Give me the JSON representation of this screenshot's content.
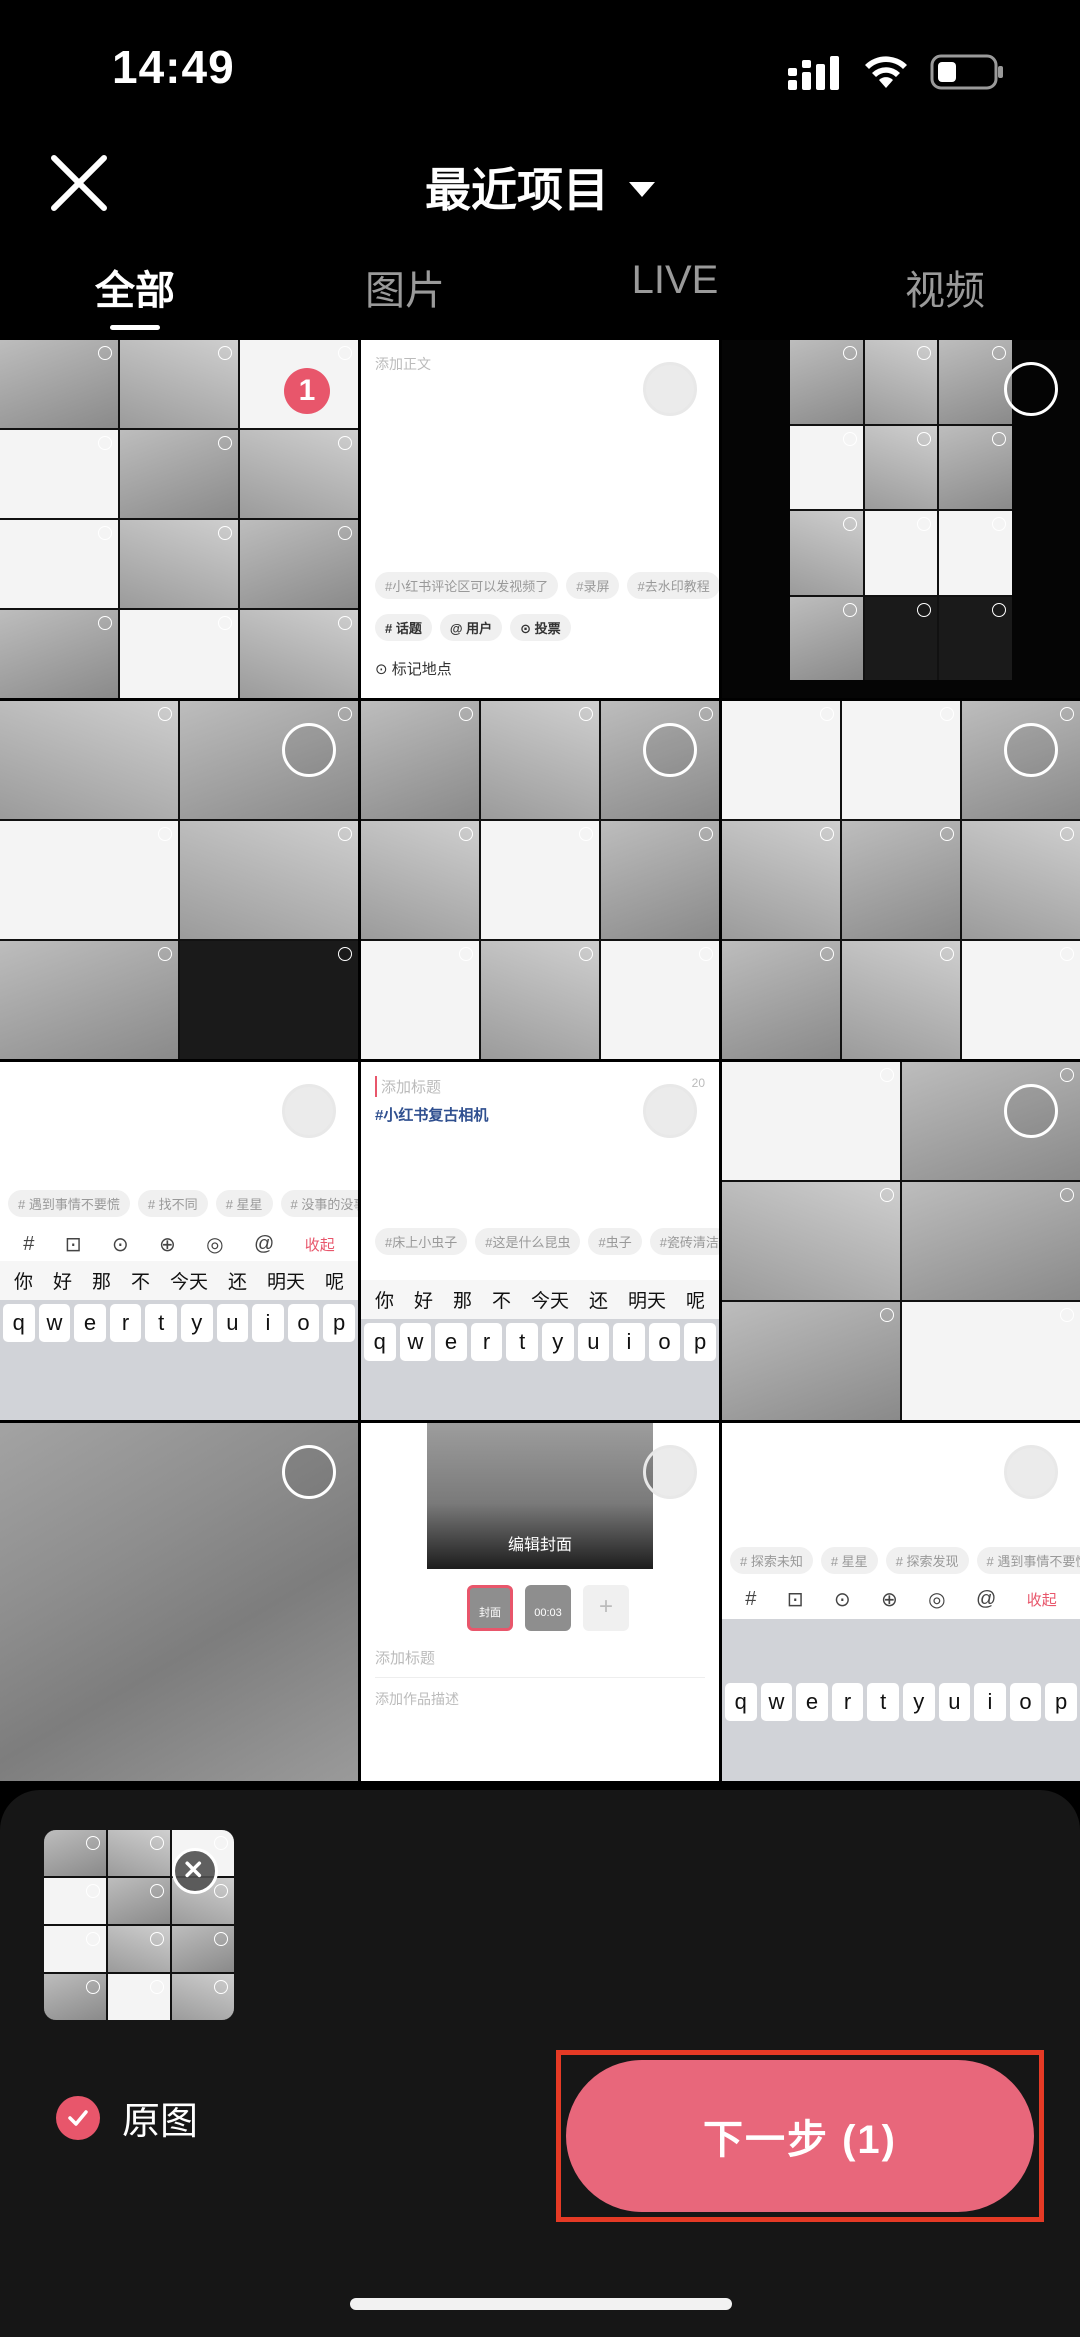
{
  "status_bar": {
    "time": "14:49",
    "signal_icon": "signal-bars-icon",
    "wifi_icon": "wifi-icon",
    "battery_icon": "battery-low-icon"
  },
  "header": {
    "title": "最近项目",
    "close_icon": "close-icon",
    "dropdown_icon": "caret-down-icon"
  },
  "tabs": [
    {
      "label": "全部",
      "active": true
    },
    {
      "label": "图片",
      "active": false
    },
    {
      "label": "LIVE",
      "active": false
    },
    {
      "label": "视频",
      "active": false
    }
  ],
  "grid": {
    "thumbs": [
      {
        "kind": "mosaic",
        "selected_index": "1"
      },
      {
        "kind": "post-editor",
        "placeholder": "添加正文",
        "tags": [
          "#小红书评论区可以发视频了",
          "#录屏",
          "#去水印教程"
        ],
        "actions": [
          "# 话题",
          "@ 用户",
          "⊙ 投票"
        ],
        "location": "标记地点"
      },
      {
        "kind": "phone-screenshot"
      },
      {
        "kind": "mosaic"
      },
      {
        "kind": "mosaic"
      },
      {
        "kind": "mosaic"
      },
      {
        "kind": "keyboard-page",
        "tags": [
          "# 遇到事情不要慌",
          "# 找不同",
          "# 星星",
          "# 没事的没事"
        ],
        "collapse": "收起",
        "candidates": [
          "你",
          "好",
          "那",
          "不",
          "今天",
          "还",
          "明天",
          "呢"
        ]
      },
      {
        "kind": "keyboard-title",
        "title_placeholder": "添加标题",
        "counter": "20",
        "hashtag": "#小红书复古相机",
        "tags": [
          "#床上小虫子",
          "#这是什么昆虫",
          "#虫子",
          "#瓷砖清洁"
        ],
        "candidates": [
          "你",
          "好",
          "那",
          "不",
          "今天",
          "还",
          "明天",
          "呢"
        ]
      },
      {
        "kind": "mosaic"
      },
      {
        "kind": "gray-photo"
      },
      {
        "kind": "cover-editor",
        "cover_label": "编辑封面",
        "cover_tag": "封面",
        "duration": "00:03",
        "title_placeholder": "添加标题",
        "desc_placeholder": "添加作品描述"
      },
      {
        "kind": "keyboard-only",
        "tags": [
          "# 探索未知",
          "# 星星",
          "# 探索发现",
          "# 遇到事情不要慌"
        ],
        "collapse": "收起"
      }
    ],
    "keys": [
      "q",
      "w",
      "e",
      "r",
      "t",
      "y",
      "u",
      "i",
      "o",
      "p"
    ]
  },
  "bottom_panel": {
    "remove_icon": "close-icon",
    "original_label": "原图",
    "original_checked": true,
    "next_button": "下一步 (1)",
    "accent_color": "#e8677b",
    "highlight_color": "#e53a25"
  }
}
